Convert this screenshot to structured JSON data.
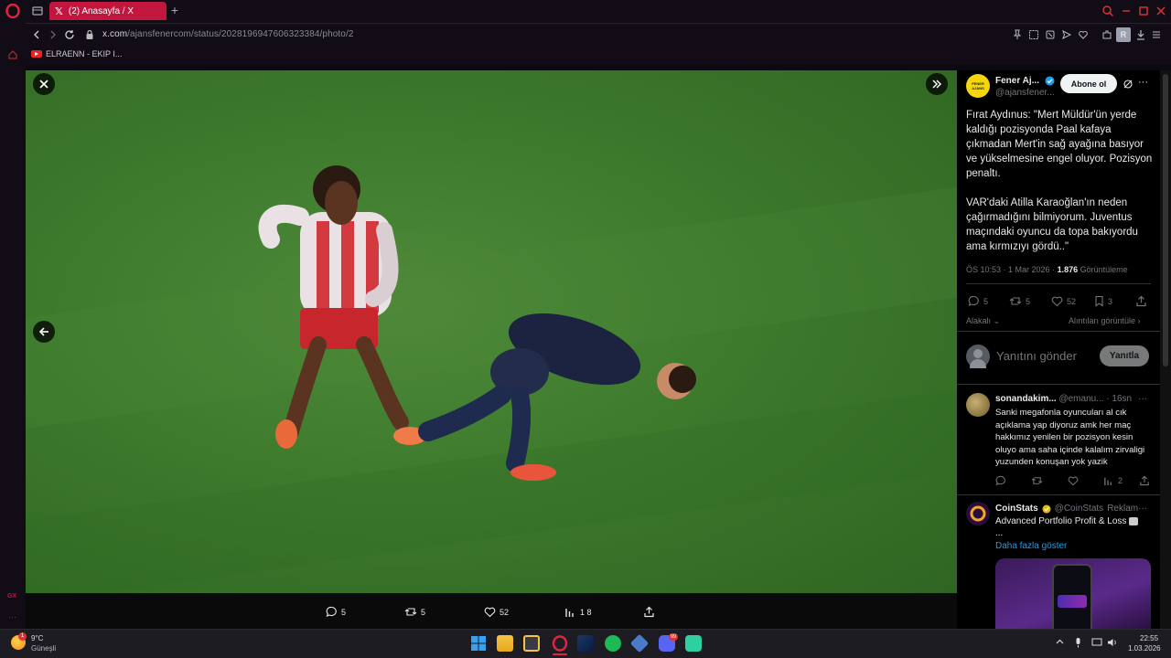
{
  "browser": {
    "tab_title": "(2) Anasayfa / X",
    "url_host": "x.com",
    "url_path": "/ajansfenercom/status/2028196947606323384/photo/2",
    "bookmark": "ELRAENN - EKIP I..."
  },
  "photo_viewer": {
    "actions": {
      "replies": "5",
      "reposts": "5",
      "likes": "52",
      "views": "1 8"
    }
  },
  "tweet": {
    "author_name": "Fener Aj...",
    "author_handle": "@ajansfener...",
    "follow_label": "Abone ol",
    "avatar_text": "FENER AJANS",
    "paragraph1": "Fırat Aydınus: \"Mert Müldür'ün yerde kaldığı pozisyonda Paal kafaya çıkmadan Mert'in sağ ayağına basıyor ve yükselmesine engel oluyor. Pozisyon penaltı.",
    "paragraph2": "VAR'daki Atilla Karaoğlan'ın neden çağırmadığını bilmiyorum. Juventus maçındaki oyuncu da topa bakıyordu ama kırmızıyı gördü..\"",
    "time_date": "ÖS 10:53 · 1 Mar 2026 ·",
    "views_count": "1.876",
    "views_label": "Görüntüleme",
    "stats": {
      "replies": "5",
      "reposts": "5",
      "likes": "52",
      "bookmarks": "3"
    },
    "sort_label": "Alakalı",
    "quotes_label": "Alıntıları görüntüle",
    "reply_placeholder": "Yanıtını gönder",
    "reply_button": "Yanıtla"
  },
  "reply": {
    "name": "sonandakim...",
    "handle": "@emanu...",
    "time": "· 16sn",
    "text": "Sanki megafonla oyuncuları al cık açıklama yap diyoruz amk her maç hakkımız yenilen bir pozisyon kesin oluyo ama saha içinde kalalım zirvaligi yuzunden konuşan yok yazik",
    "views": "2"
  },
  "ad": {
    "name": "CoinStats",
    "handle": "@CoinStats",
    "label": "Reklam",
    "text": "Advanced Portfolio Profit & Loss",
    "ellipsis": "...",
    "show_more": "Daha fazla göster"
  },
  "taskbar": {
    "temperature": "9°C",
    "weather": "Güneşli",
    "time": "22:55",
    "date": "1.03.2026",
    "discord_badge": "99",
    "weather_badge": "1"
  },
  "colors": {
    "opera_red": "#c2163e",
    "x_blue": "#1d9bf0",
    "pitch_green": "#3d7a2c"
  }
}
